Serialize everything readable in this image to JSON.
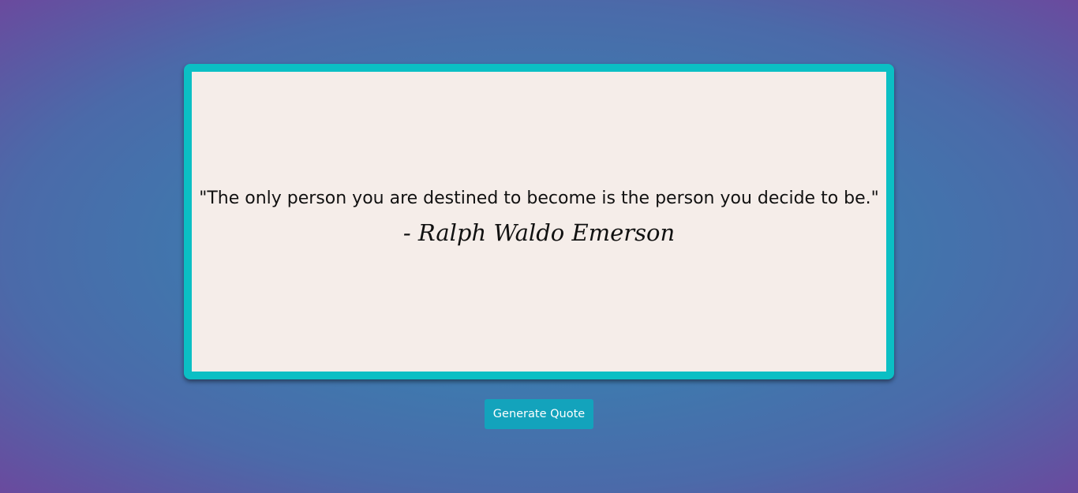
{
  "quote": {
    "text": "\"The only person you are destined to become is the person you decide to be.\"",
    "author": "- Ralph Waldo Emerson"
  },
  "actions": {
    "generate_label": "Generate Quote"
  },
  "colors": {
    "card_border": "#0bbfc4",
    "card_background": "#f5ede9",
    "button_background": "#13a3bc",
    "page_gradient_center": "#2a8bb5",
    "page_gradient_edge": "#6a4a9e"
  }
}
